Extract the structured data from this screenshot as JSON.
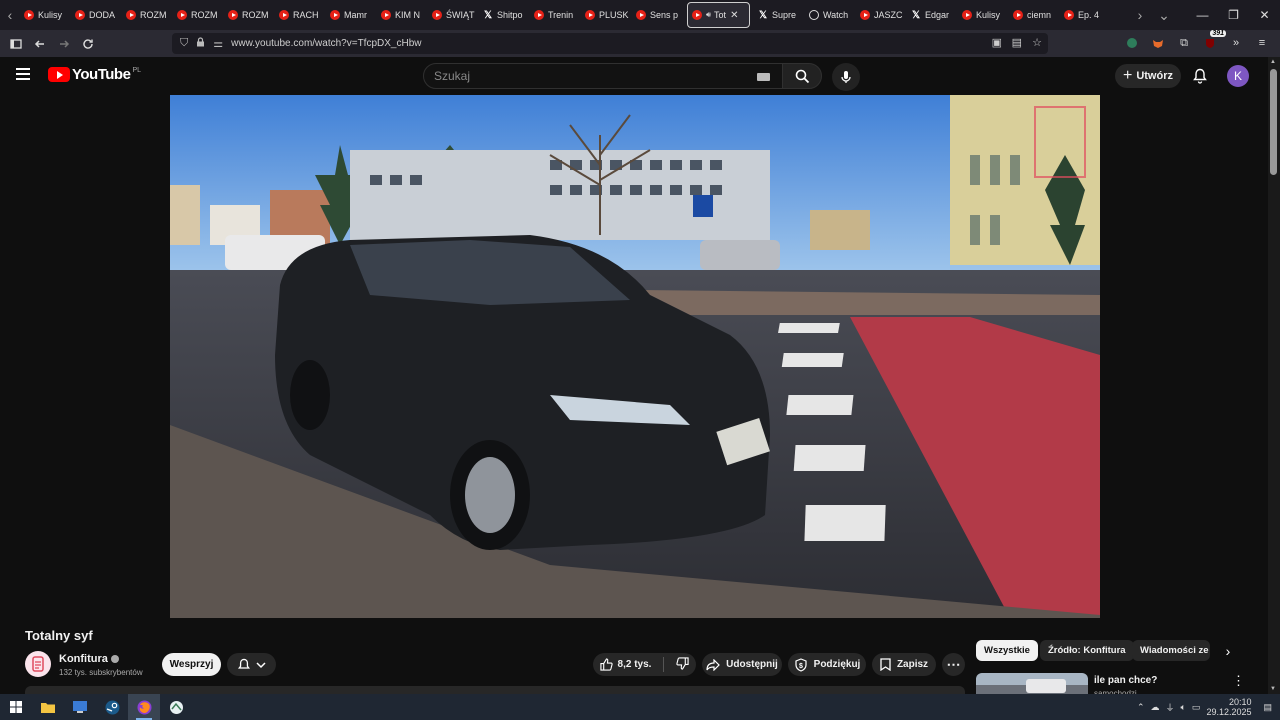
{
  "browser": {
    "tabs": [
      {
        "label": "Kulisy",
        "icon": "youtube-icon"
      },
      {
        "label": "DODA",
        "icon": "youtube-icon"
      },
      {
        "label": "ROZM",
        "icon": "youtube-icon"
      },
      {
        "label": "ROZM",
        "icon": "youtube-icon"
      },
      {
        "label": "ROZM",
        "icon": "youtube-icon"
      },
      {
        "label": "RACH",
        "icon": "youtube-icon"
      },
      {
        "label": "Mamr",
        "icon": "youtube-icon"
      },
      {
        "label": "KIM N",
        "icon": "youtube-icon"
      },
      {
        "label": "ŚWIĄT",
        "icon": "youtube-icon"
      },
      {
        "label": "Shitpo",
        "icon": "x-icon"
      },
      {
        "label": "Trenin",
        "icon": "youtube-icon"
      },
      {
        "label": "PLUSK",
        "icon": "youtube-icon"
      },
      {
        "label": "Sens p",
        "icon": "youtube-icon"
      },
      {
        "label": "Tot",
        "icon": "youtube-icon",
        "active": true
      },
      {
        "label": "Supre",
        "icon": "x-icon"
      },
      {
        "label": "Watch",
        "icon": "watch-icon"
      },
      {
        "label": "JASZC",
        "icon": "youtube-icon"
      },
      {
        "label": "Edgar",
        "icon": "x-icon"
      },
      {
        "label": "Kulisy",
        "icon": "youtube-icon"
      },
      {
        "label": "ciemn",
        "icon": "youtube-icon"
      },
      {
        "label": "Ep. 4",
        "icon": "youtube-icon"
      }
    ],
    "url": "www.youtube.com/watch?v=TfcpDX_cHbw",
    "extension_badge": "391"
  },
  "youtube": {
    "logo_text": "YouTube",
    "country_code": "PL",
    "search_placeholder": "Szukaj",
    "create_label": "Utwórz",
    "avatar_letter": "K"
  },
  "video": {
    "title": "Totalny syf",
    "channel": "Konfitura",
    "subscribers": "132 tys. subskrybentów",
    "support_label": "Wesprzyj",
    "likes": "8,2 tys.",
    "share_label": "Udostępnij",
    "thanks_label": "Podziękuj",
    "save_label": "Zapisz"
  },
  "sidebar": {
    "chips": [
      "Wszystkie",
      "Źródło: Konfitura",
      "Wiadomości ze ś"
    ],
    "recommendation": {
      "title": "ile pan chce?",
      "channel": "samochodzi"
    }
  },
  "taskbar": {
    "time": "20:10",
    "date": "29.12.2025"
  },
  "colors": {
    "youtube_red": "#ff0000",
    "background": "#0f0f0f",
    "bike_lane": "#b23a48",
    "avatar": "#7e57c2"
  }
}
